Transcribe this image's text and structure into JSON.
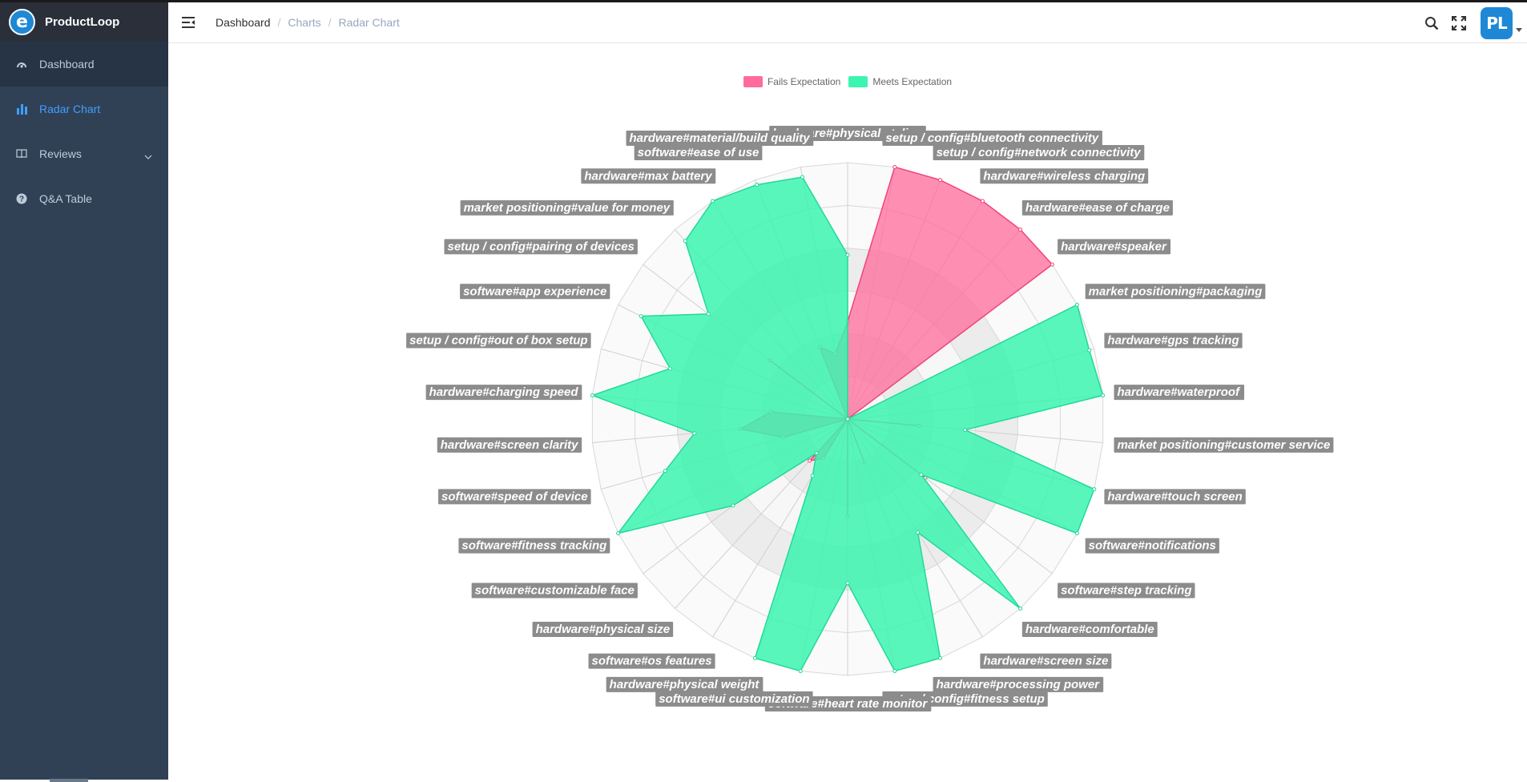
{
  "app": {
    "name": "ProductLoop",
    "logo_letter": "e"
  },
  "sidebar": {
    "items": [
      {
        "label": "Dashboard",
        "icon": "dashboard-icon"
      },
      {
        "label": "Radar Chart",
        "icon": "bar-chart-icon"
      },
      {
        "label": "Reviews",
        "icon": "book-icon"
      },
      {
        "label": "Q&A Table",
        "icon": "question-circle-icon"
      }
    ]
  },
  "breadcrumb": {
    "home": "Dashboard",
    "charts": "Charts",
    "current": "Radar Chart"
  },
  "header": {
    "avatar_initials": "PL"
  },
  "colors": {
    "fails": "#ff6b9a",
    "meets": "#3cf5b0",
    "sidebar": "#304156",
    "accent": "#409eff"
  },
  "chart_data": {
    "type": "radar",
    "rmax": 5,
    "legend_placement": "top-center",
    "categories": [
      "hardware#physical styling",
      "setup / config#bluetooth connectivity",
      "setup / config#network connectivity",
      "hardware#wireless charging",
      "hardware#ease of charge",
      "hardware#speaker",
      "market positioning#packaging",
      "hardware#gps tracking",
      "hardware#waterproof",
      "market positioning#customer service",
      "hardware#touch screen",
      "software#notifications",
      "software#step tracking",
      "hardware#comfortable",
      "hardware#screen size",
      "hardware#processing power",
      "setup / config#fitness setup",
      "software#heart rate monitor",
      "software#ui customization",
      "hardware#physical weight",
      "software#os features",
      "hardware#physical size",
      "software#customizable face",
      "software#fitness tracking",
      "software#speed of device",
      "hardware#screen clarity",
      "hardware#charging speed",
      "setup / config#out of box setup",
      "software#app experience",
      "setup / config#pairing of devices",
      "market positioning#value for money",
      "hardware#max battery",
      "software#ease of use",
      "hardware#material/build quality"
    ],
    "series": [
      {
        "name": "Fails Expectation",
        "values": [
          1.9,
          5.0,
          5.0,
          5.0,
          5.0,
          5.0,
          0,
          0,
          0,
          1.4,
          0,
          0,
          1.9,
          0,
          0,
          0.9,
          0,
          1.9,
          0,
          0,
          0.9,
          1.1,
          0,
          0,
          1.3,
          2.1,
          1.5,
          0,
          0,
          1.9,
          0,
          0,
          1.5,
          1.3
        ]
      },
      {
        "name": "Meets Expectation",
        "values": [
          3.2,
          0,
          0,
          0,
          0,
          0,
          5.0,
          4.9,
          5.0,
          2.3,
          5.0,
          5.0,
          1.8,
          5.0,
          2.6,
          5.0,
          5.0,
          3.2,
          5.0,
          5.0,
          1.3,
          0.9,
          2.8,
          5.0,
          3.7,
          3.0,
          5.0,
          3.6,
          4.5,
          3.4,
          4.7,
          5.0,
          4.9,
          4.8
        ]
      }
    ]
  }
}
